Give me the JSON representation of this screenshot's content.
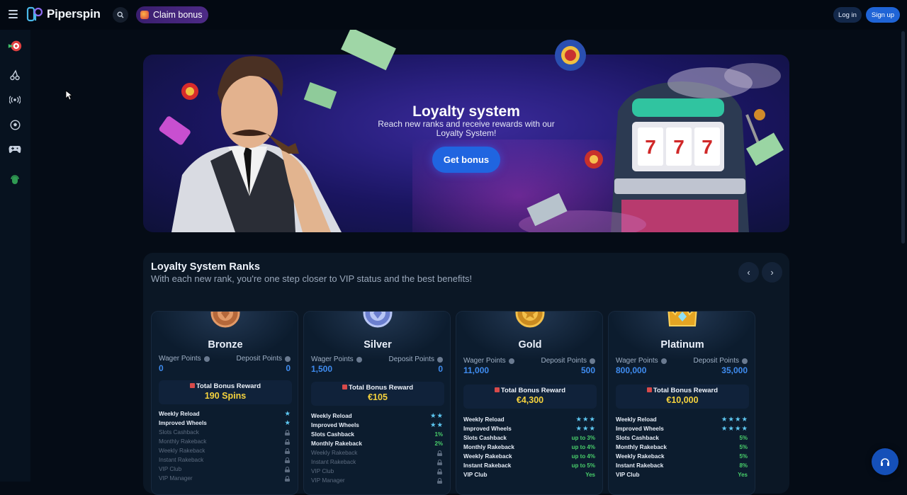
{
  "header": {
    "brand": "Piperspin",
    "claim_bonus": "Claim bonus",
    "login": "Log in",
    "signup": "Sign up"
  },
  "sidebar": {
    "items": [
      "casino-icon",
      "cherry-icon",
      "live-icon",
      "sports-ball-icon",
      "gamepad-icon",
      "support-agent-icon"
    ]
  },
  "hero": {
    "title": "Loyalty system",
    "subtitle": "Reach new ranks and receive rewards with our Loyalty System!",
    "cta": "Get bonus"
  },
  "ranks": {
    "title": "Loyalty System Ranks",
    "subtitle": "With each new rank, you're one step closer to VIP status and the best benefits!",
    "wager_label": "Wager Points",
    "deposit_label": "Deposit Points",
    "reward_label": "Total Bonus Reward",
    "cards": [
      {
        "name": "Bronze",
        "wager": "0",
        "deposit": "0",
        "reward": "190 Spins",
        "benefits": [
          {
            "name": "Weekly Reload",
            "value": "",
            "stars": 1,
            "locked": false
          },
          {
            "name": "Improved Wheels",
            "value": "",
            "stars": 1,
            "locked": false
          },
          {
            "name": "Slots Cashback",
            "value": "",
            "stars": 0,
            "locked": true
          },
          {
            "name": "Monthly Rakeback",
            "value": "",
            "stars": 0,
            "locked": true
          },
          {
            "name": "Weekly Rakeback",
            "value": "",
            "stars": 0,
            "locked": true
          },
          {
            "name": "Instant Rakeback",
            "value": "",
            "stars": 0,
            "locked": true
          },
          {
            "name": "VIP Club",
            "value": "",
            "stars": 0,
            "locked": true
          },
          {
            "name": "VIP Manager",
            "value": "",
            "stars": 0,
            "locked": true
          }
        ]
      },
      {
        "name": "Silver",
        "wager": "1,500",
        "deposit": "0",
        "reward": "€105",
        "benefits": [
          {
            "name": "Weekly Reload",
            "value": "",
            "stars": 2,
            "locked": false
          },
          {
            "name": "Improved Wheels",
            "value": "",
            "stars": 2,
            "locked": false
          },
          {
            "name": "Slots Cashback",
            "value": "1%",
            "stars": 0,
            "locked": false
          },
          {
            "name": "Monthly Rakeback",
            "value": "2%",
            "stars": 0,
            "locked": false
          },
          {
            "name": "Weekly Rakeback",
            "value": "",
            "stars": 0,
            "locked": true
          },
          {
            "name": "Instant Rakeback",
            "value": "",
            "stars": 0,
            "locked": true
          },
          {
            "name": "VIP Club",
            "value": "",
            "stars": 0,
            "locked": true
          },
          {
            "name": "VIP Manager",
            "value": "",
            "stars": 0,
            "locked": true
          }
        ]
      },
      {
        "name": "Gold",
        "wager": "11,000",
        "deposit": "500",
        "reward": "€4,300",
        "benefits": [
          {
            "name": "Weekly Reload",
            "value": "",
            "stars": 3,
            "locked": false
          },
          {
            "name": "Improved Wheels",
            "value": "",
            "stars": 3,
            "locked": false
          },
          {
            "name": "Slots Cashback",
            "value": "up to 3%",
            "stars": 0,
            "locked": false
          },
          {
            "name": "Monthly Rakeback",
            "value": "up to 4%",
            "stars": 0,
            "locked": false
          },
          {
            "name": "Weekly Rakeback",
            "value": "up to 4%",
            "stars": 0,
            "locked": false
          },
          {
            "name": "Instant Rakeback",
            "value": "up to 5%",
            "stars": 0,
            "locked": false
          },
          {
            "name": "VIP Club",
            "value": "Yes",
            "stars": 0,
            "locked": false
          }
        ]
      },
      {
        "name": "Platinum",
        "wager": "800,000",
        "deposit": "35,000",
        "reward": "€10,000",
        "benefits": [
          {
            "name": "Weekly Reload",
            "value": "",
            "stars": 4,
            "locked": false
          },
          {
            "name": "Improved Wheels",
            "value": "",
            "stars": 4,
            "locked": false
          },
          {
            "name": "Slots Cashback",
            "value": "5%",
            "stars": 0,
            "locked": false
          },
          {
            "name": "Monthly Rakeback",
            "value": "5%",
            "stars": 0,
            "locked": false
          },
          {
            "name": "Weekly Rakeback",
            "value": "5%",
            "stars": 0,
            "locked": false
          },
          {
            "name": "Instant Rakeback",
            "value": "8%",
            "stars": 0,
            "locked": false
          },
          {
            "name": "VIP Club",
            "value": "Yes",
            "stars": 0,
            "locked": false
          }
        ]
      }
    ]
  },
  "colors": {
    "accent": "#2065e0",
    "reward": "#f6d33d",
    "value_green": "#49d06b",
    "points_blue": "#3f8cf0",
    "star": "#5ec8f2"
  }
}
